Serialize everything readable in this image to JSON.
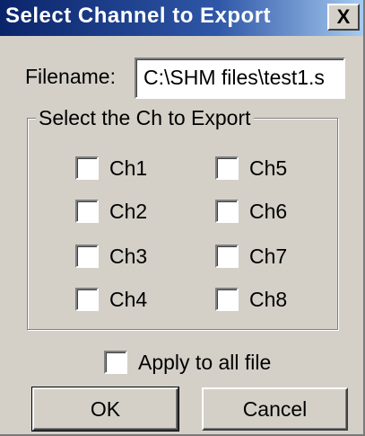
{
  "window": {
    "title": "Select Channel to Export",
    "close_glyph": "X"
  },
  "filename": {
    "label": "Filename:",
    "value": "C:\\SHM files\\test1.s"
  },
  "group": {
    "label": "Select the Ch to Export"
  },
  "channels": [
    {
      "label": "Ch1",
      "checked": false
    },
    {
      "label": "Ch2",
      "checked": false
    },
    {
      "label": "Ch3",
      "checked": false
    },
    {
      "label": "Ch4",
      "checked": false
    },
    {
      "label": "Ch5",
      "checked": false
    },
    {
      "label": "Ch6",
      "checked": false
    },
    {
      "label": "Ch7",
      "checked": false
    },
    {
      "label": "Ch8",
      "checked": false
    }
  ],
  "apply_all": {
    "label": "Apply to all file",
    "checked": false
  },
  "buttons": {
    "ok_label": "OK",
    "cancel_label": "Cancel"
  },
  "colors": {
    "face": "#d4d0c8",
    "title_start": "#0a246a",
    "title_end": "#a6caf0"
  }
}
